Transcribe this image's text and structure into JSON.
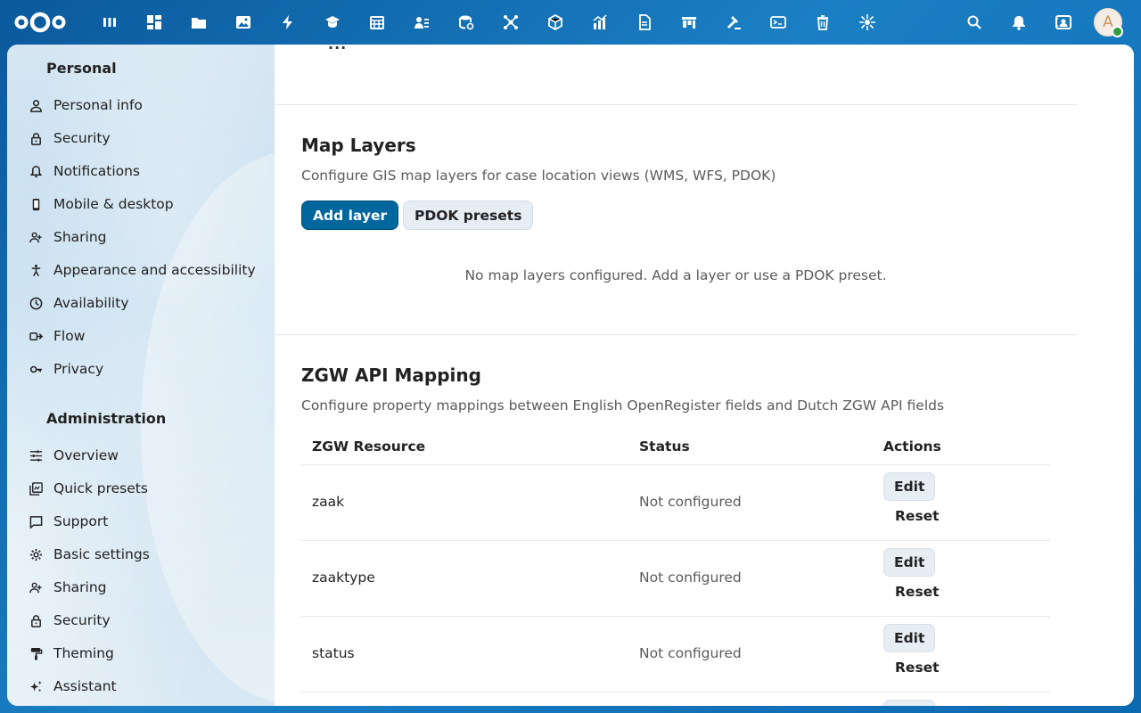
{
  "colors": {
    "header_bg": "#0b69b0",
    "primary": "#00679e",
    "status_online": "#2d9b3e"
  },
  "header": {
    "logo": "nextcloud-logo",
    "app_icons": [
      "dashboard-icon",
      "apps-grid-icon",
      "files-icon",
      "photos-icon",
      "activity-icon",
      "learning-icon",
      "calendar-icon",
      "contacts-icon",
      "database-icon",
      "network-icon",
      "package-icon",
      "chart-icon",
      "document-icon",
      "kanban-icon",
      "gavel-icon",
      "terminal-icon",
      "trash-icon",
      "settings-burst-icon"
    ],
    "right_icons": [
      "search-icon",
      "bell-icon",
      "contacts-menu-icon"
    ],
    "avatar_letter": "A"
  },
  "sidebar": {
    "personal_heading": "Personal",
    "personal_items": [
      {
        "label": "Personal info",
        "icon": "user-icon"
      },
      {
        "label": "Security",
        "icon": "lock-icon"
      },
      {
        "label": "Notifications",
        "icon": "bell-icon"
      },
      {
        "label": "Mobile & desktop",
        "icon": "phone-icon"
      },
      {
        "label": "Sharing",
        "icon": "share-icon"
      },
      {
        "label": "Appearance and accessibility",
        "icon": "accessibility-icon"
      },
      {
        "label": "Availability",
        "icon": "clock-icon"
      },
      {
        "label": "Flow",
        "icon": "flow-icon"
      },
      {
        "label": "Privacy",
        "icon": "key-icon"
      }
    ],
    "admin_heading": "Administration",
    "admin_items": [
      {
        "label": "Overview",
        "icon": "sliders-icon"
      },
      {
        "label": "Quick presets",
        "icon": "presets-icon"
      },
      {
        "label": "Support",
        "icon": "chat-icon"
      },
      {
        "label": "Basic settings",
        "icon": "gear-icon"
      },
      {
        "label": "Sharing",
        "icon": "share-icon"
      },
      {
        "label": "Security",
        "icon": "lock-icon"
      },
      {
        "label": "Theming",
        "icon": "paint-icon"
      },
      {
        "label": "Assistant",
        "icon": "sparkle-icon"
      }
    ]
  },
  "map_layers": {
    "title": "Map Layers",
    "description": "Configure GIS map layers for case location views (WMS, WFS, PDOK)",
    "add_button": "Add layer",
    "presets_button": "PDOK presets",
    "empty_message": "No map layers configured. Add a layer or use a PDOK preset."
  },
  "zgw": {
    "title": "ZGW API Mapping",
    "description": "Configure property mappings between English OpenRegister fields and Dutch ZGW API fields",
    "columns": [
      "ZGW Resource",
      "Status",
      "Actions"
    ],
    "edit_label": "Edit",
    "reset_label": "Reset",
    "rows": [
      {
        "resource": "zaak",
        "status": "Not configured"
      },
      {
        "resource": "zaaktype",
        "status": "Not configured"
      },
      {
        "resource": "status",
        "status": "Not configured"
      }
    ]
  }
}
